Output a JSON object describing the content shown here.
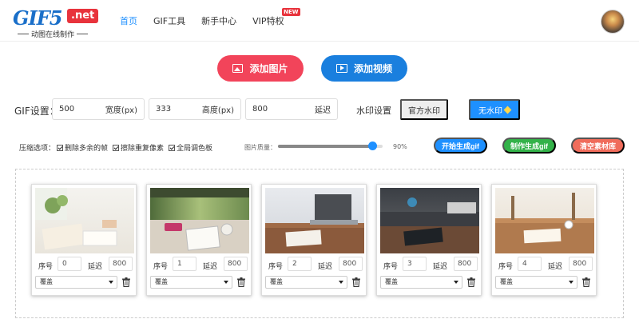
{
  "header": {
    "logo_main": "GIF5",
    "logo_net": ".net",
    "logo_sub": "动图在线制作",
    "nav": [
      {
        "label": "首页",
        "active": true
      },
      {
        "label": "GIF工具",
        "active": false
      },
      {
        "label": "新手中心",
        "active": false
      },
      {
        "label": "VIP特权",
        "active": false,
        "badge": "NEW"
      }
    ]
  },
  "actions": {
    "add_image": "添加图片",
    "add_video": "添加视频"
  },
  "settings": {
    "label": "GIF设置：",
    "width": {
      "value": "500",
      "unit": "宽度(px)"
    },
    "height": {
      "value": "333",
      "unit": "高度(px)"
    },
    "delay": {
      "value": "800",
      "unit": "延迟"
    },
    "watermark_label": "水印设置",
    "watermark_official": "官方水印",
    "watermark_none": "无水印"
  },
  "options": {
    "title": "压缩选项：",
    "items": [
      {
        "label": "删除多余的帧",
        "checked": true
      },
      {
        "label": "擦除重复像素",
        "checked": true
      },
      {
        "label": "全局调色板",
        "checked": true
      }
    ],
    "quality_label": "图片质量：",
    "quality_value": "90%",
    "quality_fraction": 0.9
  },
  "buttons": {
    "start": "开始生成gif",
    "create": "制作生成gif",
    "clear": "清空素材库"
  },
  "frames": {
    "seq_label": "序号",
    "delay_label": "延迟",
    "items": [
      {
        "seq": "0",
        "delay": "800",
        "mode": "覆盖"
      },
      {
        "seq": "1",
        "delay": "800",
        "mode": "覆盖"
      },
      {
        "seq": "2",
        "delay": "800",
        "mode": "覆盖"
      },
      {
        "seq": "3",
        "delay": "800",
        "mode": "覆盖"
      },
      {
        "seq": "4",
        "delay": "800",
        "mode": "覆盖"
      }
    ]
  },
  "icons": {
    "image": "image-icon",
    "video": "film-icon",
    "diamond": "diamond-icon",
    "trash": "trash-icon"
  },
  "colors": {
    "primary": "#1e90ff",
    "add_image": "#f2445a",
    "add_video": "#1a7fde",
    "create": "#33b249",
    "clear": "#f06c5b"
  }
}
